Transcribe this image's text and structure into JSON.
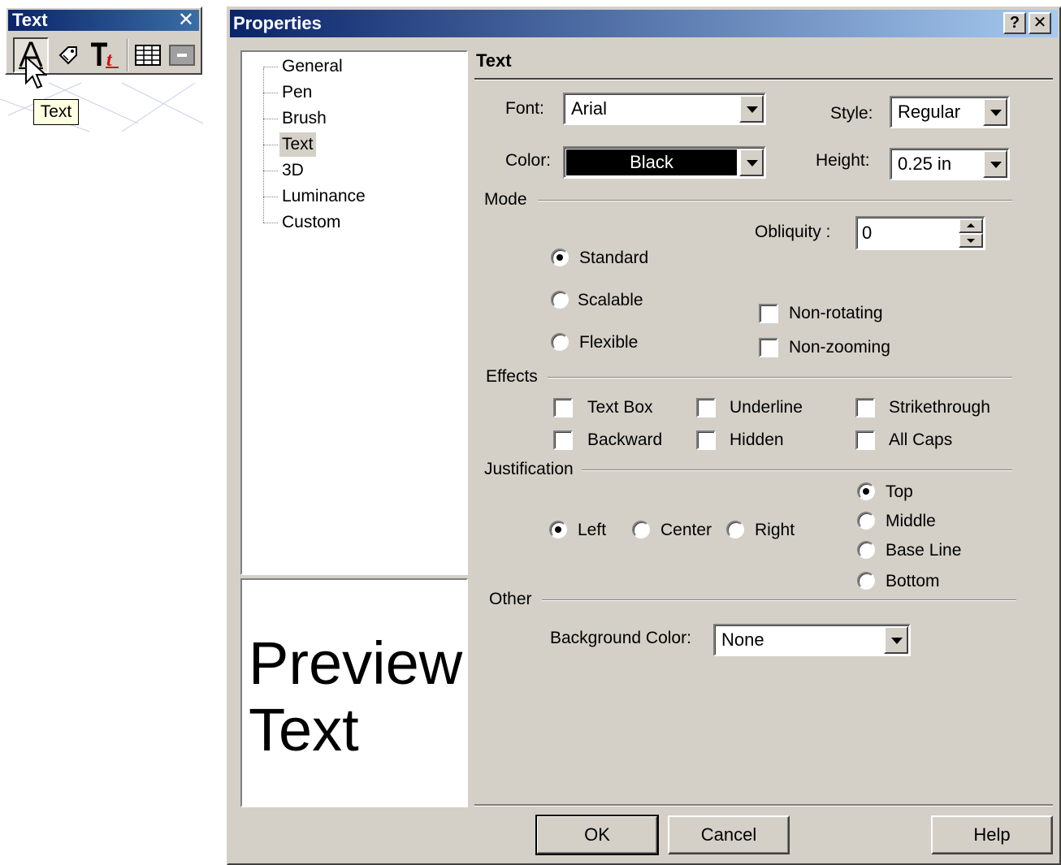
{
  "toolbar": {
    "title": "Text",
    "close_glyph": "✕",
    "buttons": [
      "text-tool-icon",
      "tag-icon",
      "text-format-icon",
      "table-icon",
      "minimize-icon"
    ],
    "tooltip": "Text"
  },
  "dialog": {
    "title": "Properties",
    "help_glyph": "?",
    "close_glyph": "✕"
  },
  "tree": {
    "items": [
      "General",
      "Pen",
      "Brush",
      "Text",
      "3D",
      "Luminance",
      "Custom"
    ],
    "selected": "Text"
  },
  "preview": {
    "line1": "Preview",
    "line2": "Text"
  },
  "panel": {
    "title": "Text",
    "font_label": "Font:",
    "font_value": "Arial",
    "style_label": "Style:",
    "style_value": "Regular",
    "color_label": "Color:",
    "color_value": "Black",
    "height_label": "Height:",
    "height_value": "0.25 in",
    "mode": {
      "label": "Mode",
      "obliquity_label": "Obliquity :",
      "obliquity_value": "0",
      "standard": "Standard",
      "scalable": "Scalable",
      "flexible": "Flexible",
      "selected": "Standard",
      "non_rotating": "Non-rotating",
      "non_zooming": "Non-zooming"
    },
    "effects": {
      "label": "Effects",
      "text_box": "Text Box",
      "underline": "Underline",
      "strikethrough": "Strikethrough",
      "backward": "Backward",
      "hidden": "Hidden",
      "all_caps": "All Caps"
    },
    "justification": {
      "label": "Justification",
      "left": "Left",
      "center": "Center",
      "right": "Right",
      "top": "Top",
      "middle": "Middle",
      "base_line": "Base Line",
      "bottom": "Bottom",
      "horizontal_selected": "Left",
      "vertical_selected": "Top"
    },
    "other": {
      "label": "Other",
      "bg_color_label": "Background Color:",
      "bg_color_value": "None"
    }
  },
  "buttons": {
    "ok": "OK",
    "cancel": "Cancel",
    "help": "Help"
  }
}
